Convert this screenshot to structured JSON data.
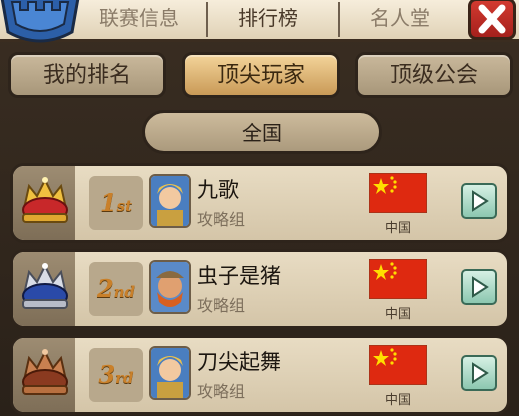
{
  "top_tabs": [
    {
      "label": "联赛信息",
      "active": false
    },
    {
      "label": "排行榜",
      "active": true
    },
    {
      "label": "名人堂",
      "active": false
    }
  ],
  "sub_tabs": [
    {
      "label": "我的排名",
      "active": false
    },
    {
      "label": "顶尖玩家",
      "active": true
    },
    {
      "label": "顶级公会",
      "active": false
    }
  ],
  "region": {
    "label": "全国"
  },
  "rows": [
    {
      "rank": "1",
      "suffix": "st",
      "crown": "gold-crown-icon",
      "name": "九歌",
      "guild": "攻略组",
      "country": "中国",
      "flag": "china-flag-icon"
    },
    {
      "rank": "2",
      "suffix": "nd",
      "crown": "silver-crown-icon",
      "name": "虫子是猪",
      "guild": "攻略组",
      "country": "中国",
      "flag": "china-flag-icon"
    },
    {
      "rank": "3",
      "suffix": "rd",
      "crown": "bronze-crown-icon",
      "name": "刀尖起舞",
      "guild": "攻略组",
      "country": "中国",
      "flag": "china-flag-icon"
    }
  ],
  "colors": {
    "accent": "#c99a57",
    "close_red": "#c0302a",
    "flag_red": "#de2910",
    "flag_yellow": "#ffde00",
    "play_green": "#8cc7b0"
  }
}
